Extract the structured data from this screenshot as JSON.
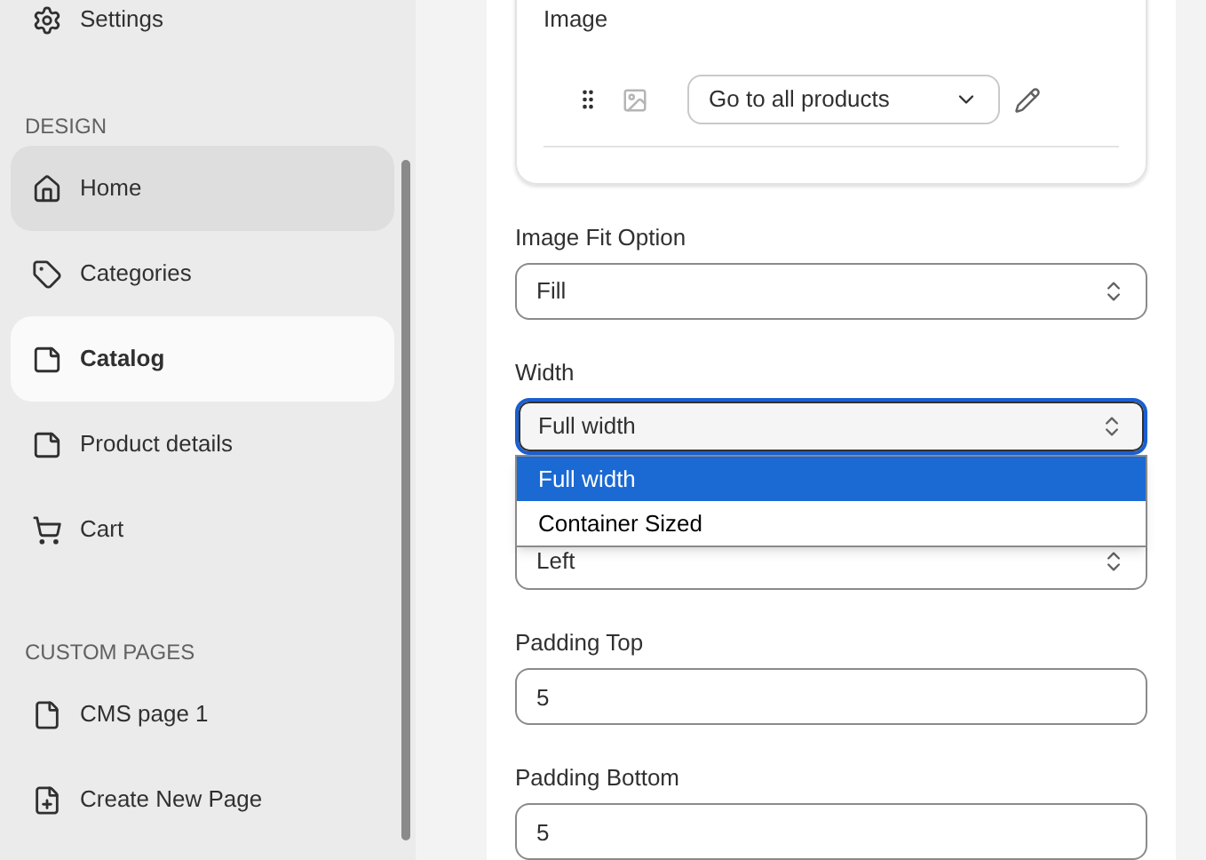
{
  "sidebar": {
    "top_item": {
      "label": "Settings"
    },
    "sections": [
      {
        "heading": "DESIGN",
        "items": [
          {
            "label": "Home",
            "selected": false,
            "hovered": true
          },
          {
            "label": "Categories",
            "selected": false,
            "hovered": false
          },
          {
            "label": "Catalog",
            "selected": true,
            "hovered": false
          },
          {
            "label": "Product details",
            "selected": false,
            "hovered": false
          },
          {
            "label": "Cart",
            "selected": false,
            "hovered": false
          }
        ]
      },
      {
        "heading": "CUSTOM PAGES",
        "items": [
          {
            "label": "CMS page 1",
            "selected": false,
            "hovered": false
          },
          {
            "label": "Create New Page",
            "selected": false,
            "hovered": false
          }
        ]
      }
    ]
  },
  "image_card": {
    "label": "Image",
    "link_select": {
      "value": "Go to all products"
    }
  },
  "fields": [
    {
      "kind": "select",
      "label": "Image Fit Option",
      "value": "Fill",
      "focused": false
    },
    {
      "kind": "select",
      "label": "Width",
      "value": "Full width",
      "focused": true,
      "options": [
        {
          "label": "Full width",
          "selected": true
        },
        {
          "label": "Container Sized",
          "selected": false
        }
      ]
    },
    {
      "kind": "select",
      "value": "Left",
      "focused": false
    },
    {
      "kind": "input",
      "label": "Padding Top",
      "value": "5",
      "focused": false
    },
    {
      "kind": "input",
      "label": "Padding Bottom",
      "value": "5",
      "focused": false
    }
  ]
}
